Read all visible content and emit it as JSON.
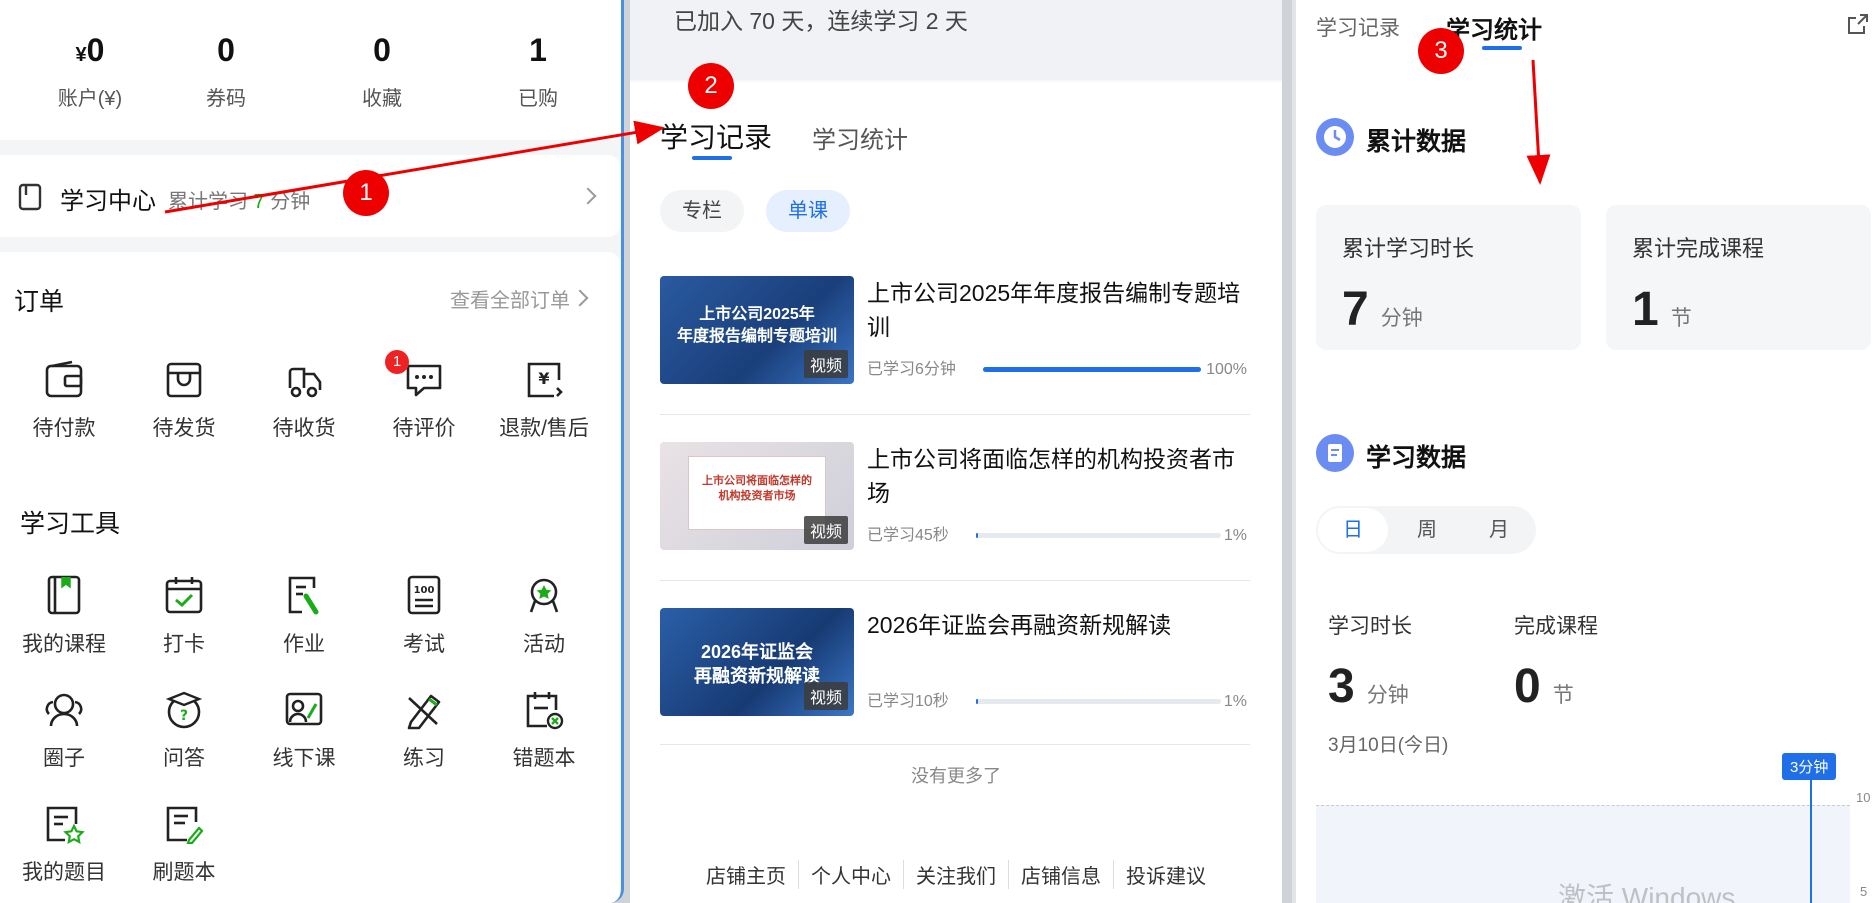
{
  "left_panel": {
    "stats": [
      {
        "prefix": "¥",
        "value": "0",
        "label": "账户(¥)"
      },
      {
        "prefix": "",
        "value": "0",
        "label": "券码"
      },
      {
        "prefix": "",
        "value": "0",
        "label": "收藏"
      },
      {
        "prefix": "",
        "value": "1",
        "label": "已购"
      }
    ],
    "study_center": {
      "title": "学习中心",
      "summary_prefix": "累计学习 ",
      "minutes": "7",
      "summary_suffix": " 分钟"
    },
    "orders": {
      "title": "订单",
      "view_all": "查看全部订单",
      "items": [
        {
          "label": "待付款",
          "icon": "wallet-icon"
        },
        {
          "label": "待发货",
          "icon": "box-icon"
        },
        {
          "label": "待收货",
          "icon": "truck-icon"
        },
        {
          "label": "待评价",
          "icon": "comment-icon",
          "badge": "1"
        },
        {
          "label": "退款/售后",
          "icon": "refund-icon"
        }
      ]
    },
    "tools": {
      "title": "学习工具",
      "items": [
        {
          "label": "我的课程",
          "icon": "book-icon"
        },
        {
          "label": "打卡",
          "icon": "calendar-check-icon"
        },
        {
          "label": "作业",
          "icon": "homework-icon"
        },
        {
          "label": "考试",
          "icon": "exam-icon"
        },
        {
          "label": "活动",
          "icon": "activity-icon"
        },
        {
          "label": "圈子",
          "icon": "group-icon"
        },
        {
          "label": "问答",
          "icon": "question-icon"
        },
        {
          "label": "线下课",
          "icon": "offline-class-icon"
        },
        {
          "label": "练习",
          "icon": "practice-icon"
        },
        {
          "label": "错题本",
          "icon": "wrong-book-icon"
        },
        {
          "label": "我的题目",
          "icon": "my-questions-icon"
        },
        {
          "label": "刷题本",
          "icon": "drill-book-icon"
        }
      ]
    }
  },
  "middle_panel": {
    "joined_text": "已加入 70 天，连续学习 2 天",
    "tabs": [
      "学习记录",
      "学习统计"
    ],
    "active_tab": "学习记录",
    "filters": [
      "专栏",
      "单课"
    ],
    "active_filter": "单课",
    "courses": [
      {
        "title": "上市公司2025年年度报告编制专题培训",
        "thumb_caption": "上市公司2025年\n年度报告编制专题培训",
        "tag": "视频",
        "studied": "已学习6分钟",
        "progress": 1.0,
        "percent": "100%"
      },
      {
        "title": "上市公司将面临怎样的机构投资者市场",
        "thumb_caption": "上市公司将面临怎样的\n机构投资者市场",
        "tag": "视频",
        "studied": "已学习45秒",
        "progress": 0.01,
        "percent": "1%"
      },
      {
        "title": "2026年证监会再融资新规解读",
        "thumb_caption": "2026年证监会\n再融资新规解读",
        "tag": "视频",
        "studied": "已学习10秒",
        "progress": 0.01,
        "percent": "1%"
      }
    ],
    "no_more": "没有更多了",
    "footer_links": [
      "店铺主页",
      "个人中心",
      "关注我们",
      "店铺信息",
      "投诉建议"
    ]
  },
  "right_panel": {
    "tabs": [
      "学习记录",
      "学习统计"
    ],
    "active_tab": "学习统计",
    "cumulative": {
      "title": "累计数据",
      "cards": [
        {
          "label": "累计学习时长",
          "value": "7",
          "unit": "分钟"
        },
        {
          "label": "累计完成课程",
          "value": "1",
          "unit": "节"
        }
      ]
    },
    "study_data": {
      "title": "学习数据",
      "periods": [
        "日",
        "周",
        "月"
      ],
      "active_period": "日",
      "metrics": [
        {
          "label": "学习时长",
          "value": "3",
          "unit": "分钟"
        },
        {
          "label": "完成课程",
          "value": "0",
          "unit": "节"
        }
      ],
      "date": "3月10日(今日)",
      "tooltip": "3分钟",
      "y_ticks": [
        "10",
        "5"
      ]
    },
    "watermark": "激活 Windows"
  },
  "annotations": [
    "1",
    "2",
    "3"
  ],
  "colors": {
    "accent": "#1e6fe8",
    "marker": "#e00000",
    "green": "#1aad19"
  }
}
